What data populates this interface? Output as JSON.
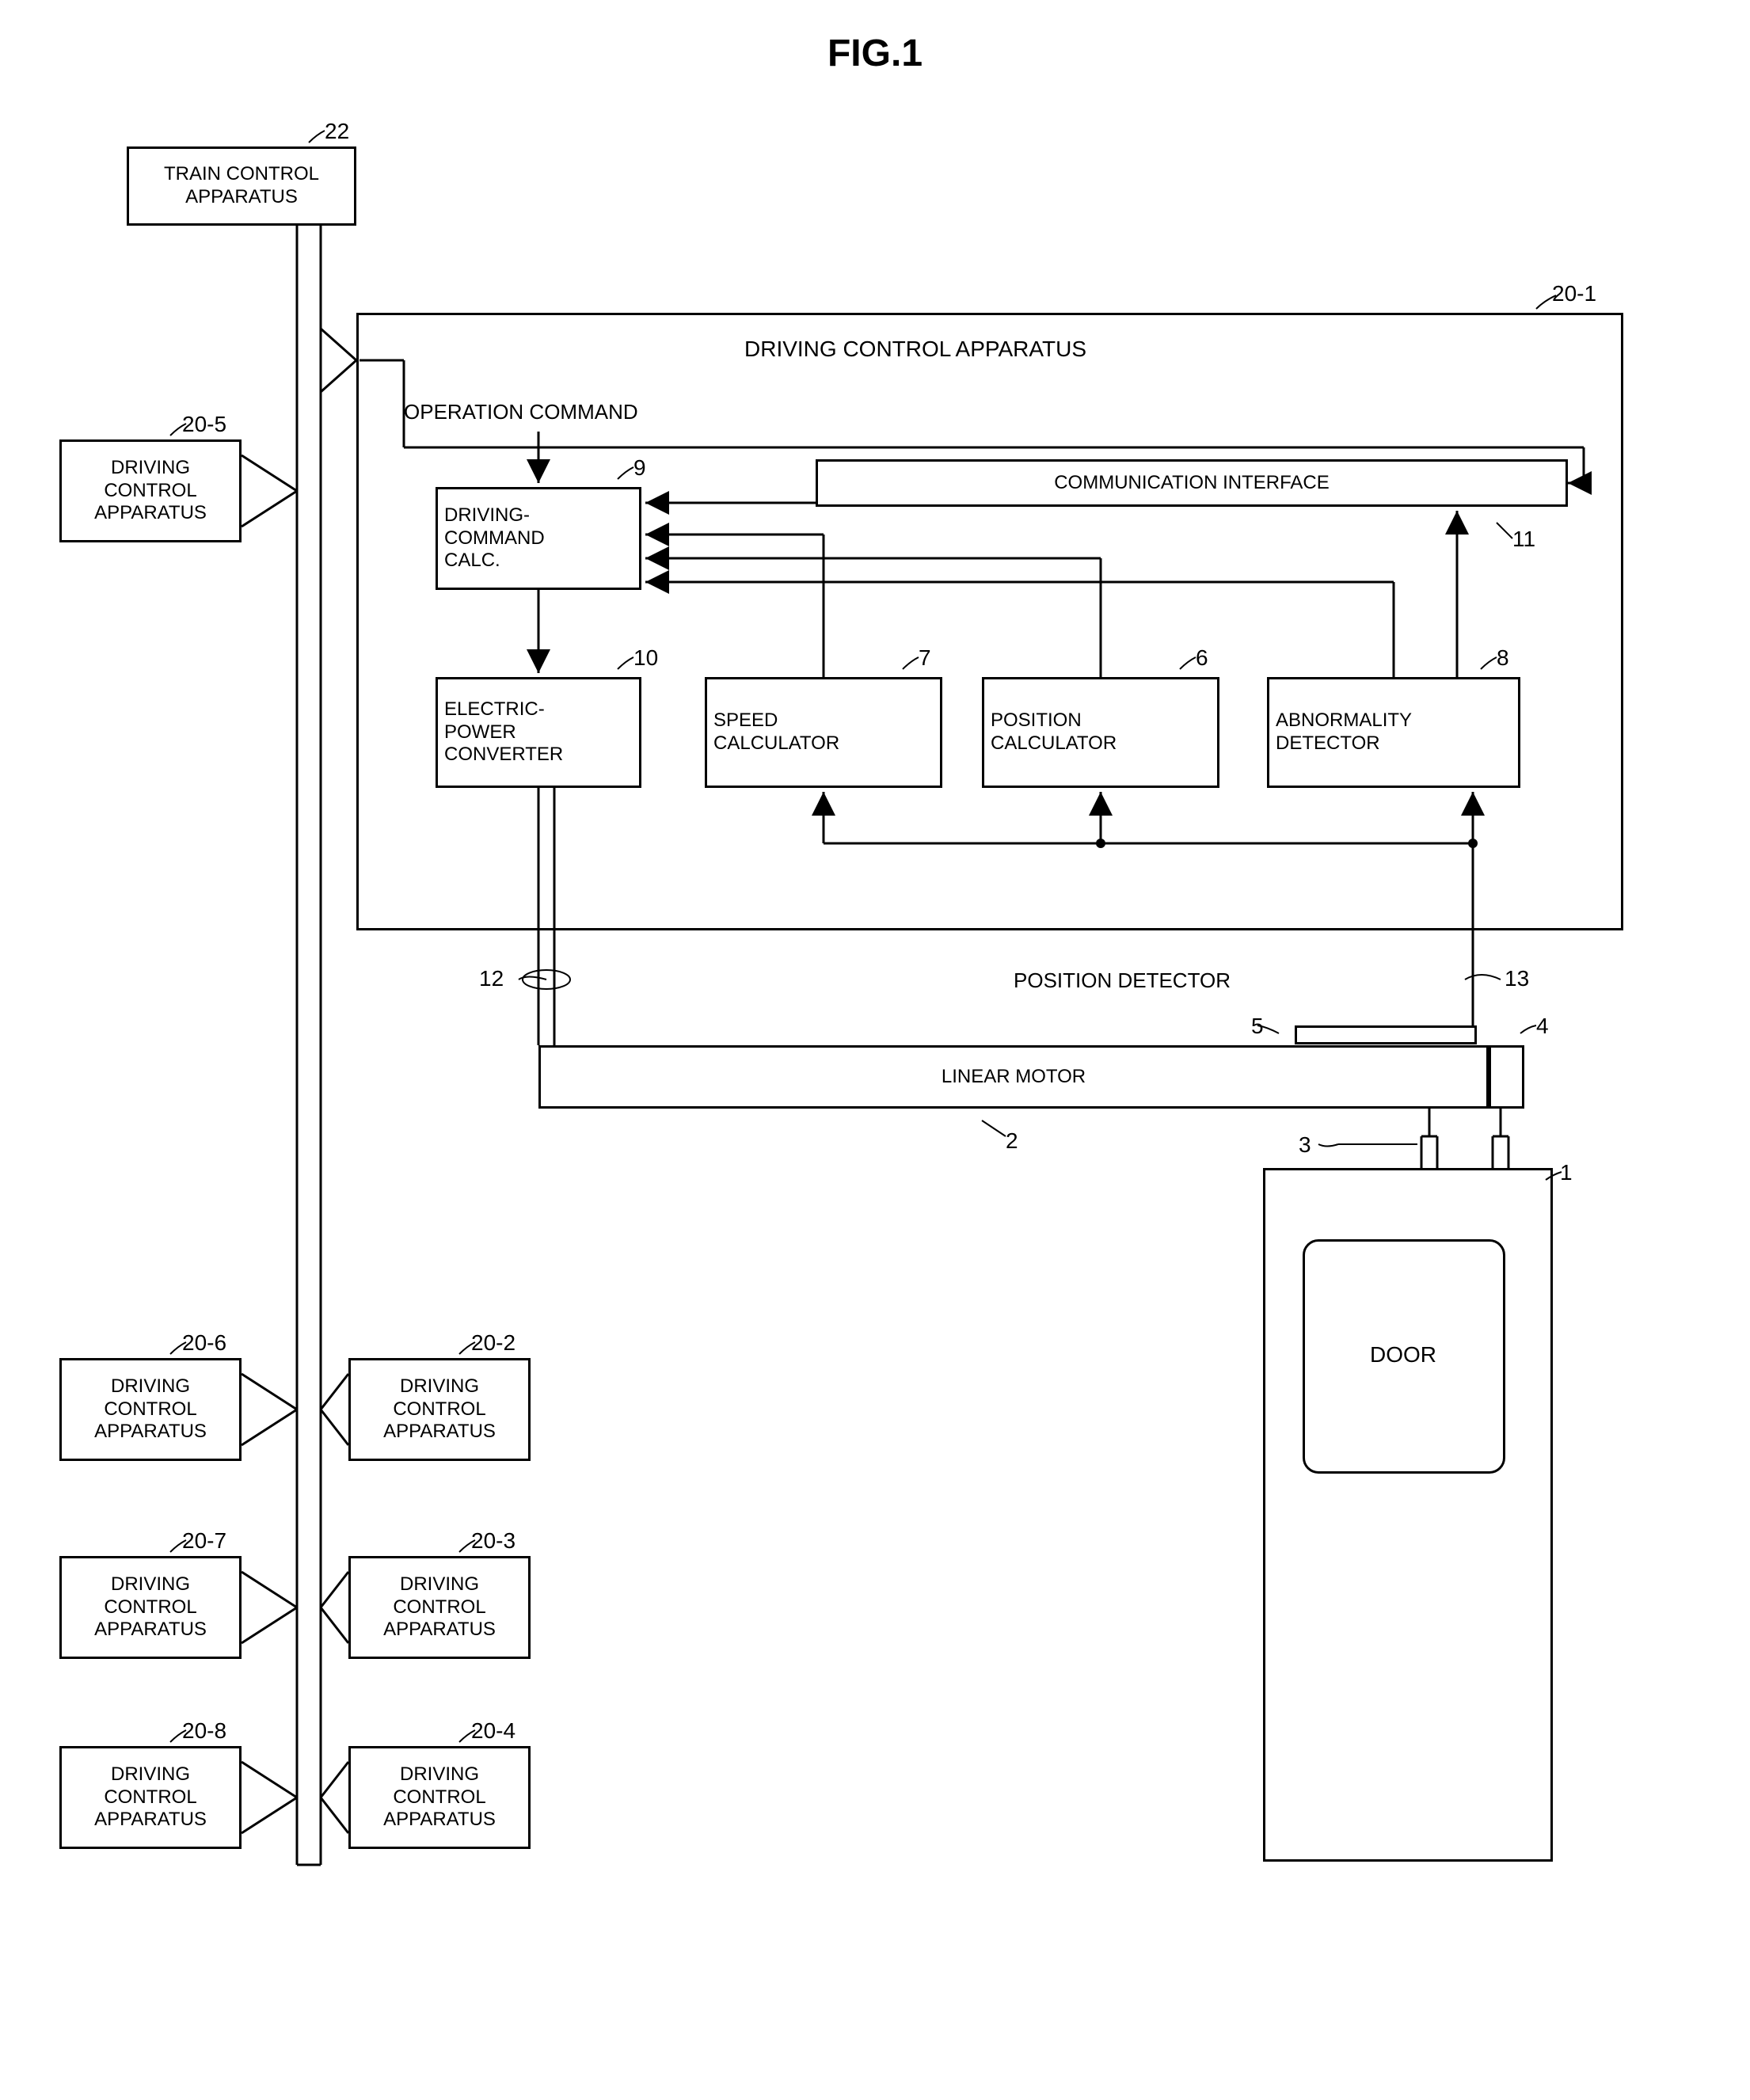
{
  "figure_title": "FIG.1",
  "blocks": {
    "train_control": "TRAIN CONTROL\nAPPARATUS",
    "dca_20_5": "DRIVING\nCONTROL\nAPPARATUS",
    "dca_20_6": "DRIVING\nCONTROL\nAPPARATUS",
    "dca_20_7": "DRIVING\nCONTROL\nAPPARATUS",
    "dca_20_8": "DRIVING\nCONTROL\nAPPARATUS",
    "dca_20_2": "DRIVING\nCONTROL\nAPPARATUS",
    "dca_20_3": "DRIVING\nCONTROL\nAPPARATUS",
    "dca_20_4": "DRIVING\nCONTROL\nAPPARATUS",
    "dca_main_title": "DRIVING CONTROL APPARATUS",
    "operation_command": "OPERATION COMMAND",
    "driving_command_calc": "DRIVING-\nCOMMAND\nCALC.",
    "comm_interface": "COMMUNICATION INTERFACE",
    "electric_power_converter": "ELECTRIC-\nPOWER\nCONVERTER",
    "speed_calculator": "SPEED\nCALCULATOR",
    "position_calculator": "POSITION\nCALCULATOR",
    "abnormality_detector": "ABNORMALITY\nDETECTOR",
    "position_detector": "POSITION DETECTOR",
    "linear_motor": "LINEAR MOTOR",
    "door": "DOOR"
  },
  "refs": {
    "r22": "22",
    "r20_5": "20-5",
    "r20_6": "20-6",
    "r20_7": "20-7",
    "r20_8": "20-8",
    "r20_2": "20-2",
    "r20_3": "20-3",
    "r20_4": "20-4",
    "r20_1": "20-1",
    "r9": "9",
    "r10": "10",
    "r7": "7",
    "r6": "6",
    "r8": "8",
    "r11": "11",
    "r12": "12",
    "r13": "13",
    "r5": "5",
    "r4": "4",
    "r2": "2",
    "r3": "3",
    "r1": "1"
  }
}
